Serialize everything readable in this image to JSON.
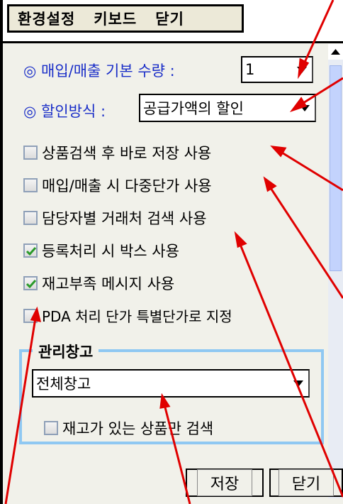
{
  "menu": {
    "items": [
      "환경설정",
      "키보드",
      "닫기"
    ]
  },
  "settings": {
    "qty_label": "◎ 매입/매출 기본 수량 :",
    "qty_value": "1",
    "discount_label": "◎ 할인방식 :",
    "discount_value": "공급가액의 할인"
  },
  "options": [
    {
      "label": "상품검색 후 바로 저장 사용",
      "checked": false
    },
    {
      "label": "매입/매출 시 다중단가 사용",
      "checked": false
    },
    {
      "label": "담당자별 거래처 검색 사용",
      "checked": false
    },
    {
      "label": "등록처리 시 박스 사용",
      "checked": true
    },
    {
      "label": "재고부족 메시지 사용",
      "checked": true
    },
    {
      "label": "PDA 처리 단가 특별단가로 지정",
      "checked": false
    }
  ],
  "warehouse": {
    "title": "관리창고",
    "value": "전체창고",
    "stock_only_label": "재고가 있는 상품만 검색",
    "stock_only_checked": false
  },
  "buttons": {
    "save": "저장",
    "close": "닫기"
  },
  "colors": {
    "blue_label": "#1a2ec8",
    "annotation": "#e00000",
    "group_border": "#8fc8f2",
    "check": "#2a9a2a"
  }
}
